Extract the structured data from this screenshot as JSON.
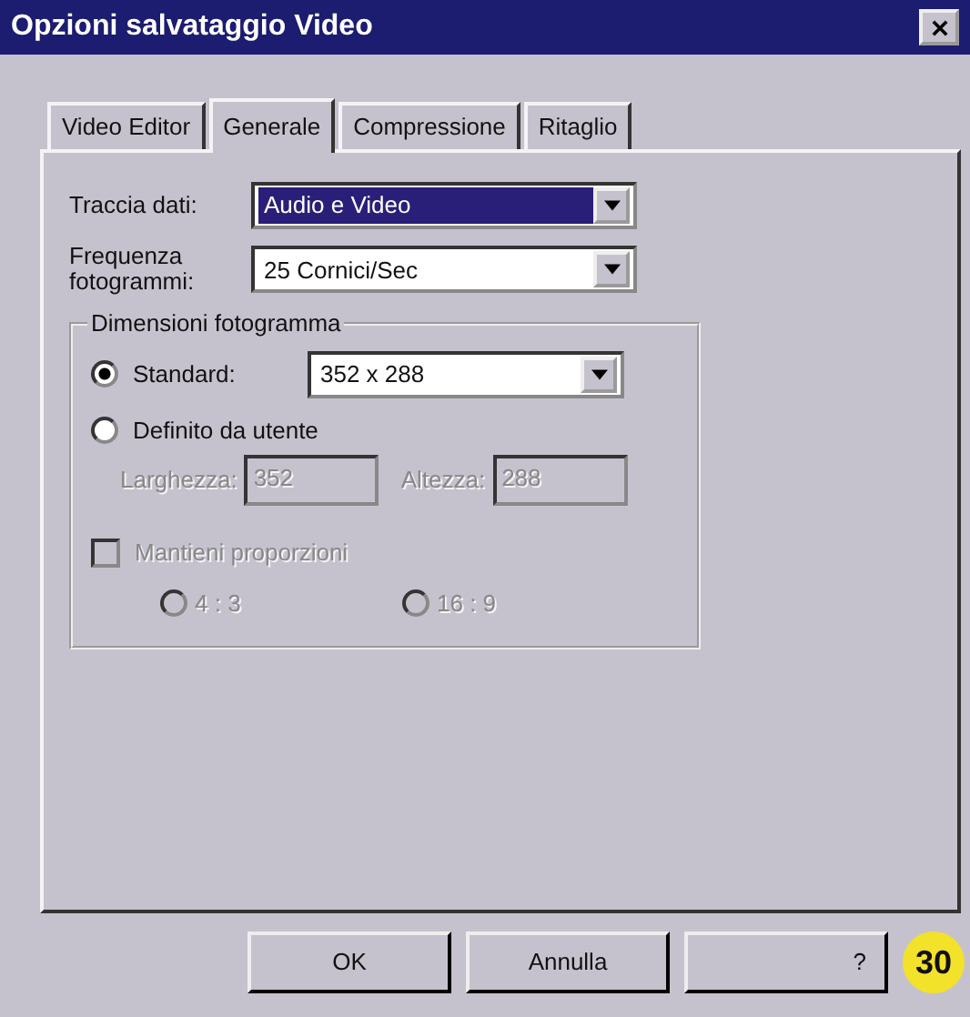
{
  "window": {
    "title": "Opzioni salvataggio Video"
  },
  "tabs": [
    {
      "label": "Video Editor",
      "selected": false
    },
    {
      "label": "Generale",
      "selected": true
    },
    {
      "label": "Compressione",
      "selected": false
    },
    {
      "label": "Ritaglio",
      "selected": false
    }
  ],
  "fields": [
    {
      "label": "Traccia dati:",
      "value": "Audio e Video",
      "highlighted": true
    },
    {
      "label": "Frequenza fotogrammi:",
      "value": "25 Cornici/Sec",
      "highlighted": false
    }
  ],
  "frame_size": {
    "title": "Dimensioni fotogramma",
    "standard": {
      "label": "Standard:",
      "selected": true,
      "value": "352 x 288"
    },
    "custom": {
      "label": "Definito da utente",
      "selected": false
    },
    "width": {
      "label": "Larghezza:",
      "value": "352",
      "disabled": true
    },
    "height": {
      "label": "Altezza:",
      "value": "288",
      "disabled": true
    },
    "keep_ratio": {
      "label": "Mantieni proporzioni",
      "checked": false,
      "disabled": true
    },
    "ratios": [
      {
        "label": "4 : 3",
        "selected": false,
        "disabled": true
      },
      {
        "label": "16 : 9",
        "selected": false,
        "disabled": true
      }
    ]
  },
  "buttons": [
    "OK",
    "Annulla",
    "?"
  ],
  "figure_number": "30"
}
